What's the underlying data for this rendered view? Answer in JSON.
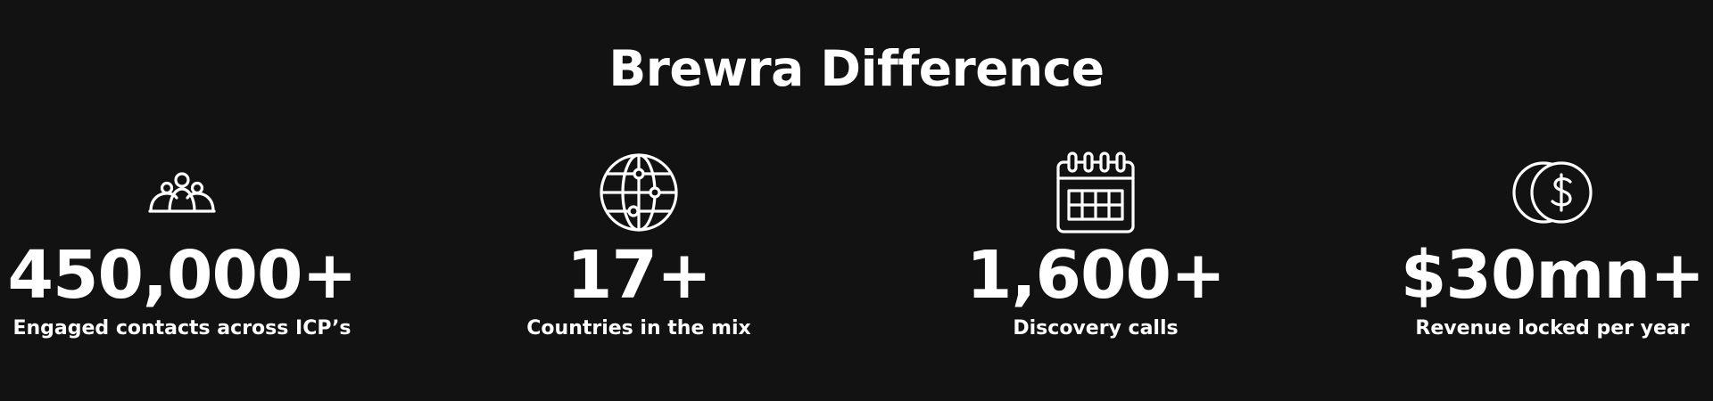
{
  "section": {
    "title": "Brewra Difference",
    "background_color": "#121212",
    "text_color": "#ffffff"
  },
  "stats": [
    {
      "icon": "group-people-icon",
      "value": "450,000+",
      "label": "Engaged contacts across ICP’s"
    },
    {
      "icon": "globe-icon",
      "value": "17+",
      "label": "Countries in the mix"
    },
    {
      "icon": "calendar-icon",
      "value": "1,600+",
      "label": "Discovery calls"
    },
    {
      "icon": "dollar-coins-icon",
      "value": "$30mn+",
      "label": "Revenue locked per year"
    }
  ]
}
